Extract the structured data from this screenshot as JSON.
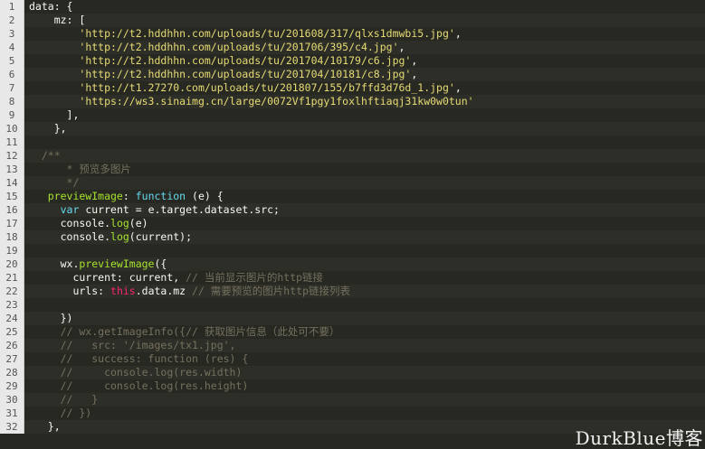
{
  "lines": [
    {
      "n": "1",
      "tokens": [
        {
          "t": "data: {",
          "c": "pl"
        }
      ]
    },
    {
      "n": "2",
      "tokens": [
        {
          "t": "    mz: [",
          "c": "pl"
        }
      ]
    },
    {
      "n": "3",
      "tokens": [
        {
          "t": "        ",
          "c": "pl"
        },
        {
          "t": "'http://t2.hddhhn.com/uploads/tu/201608/317/qlxs1dmwbi5.jpg'",
          "c": "str"
        },
        {
          "t": ",",
          "c": "pl"
        }
      ]
    },
    {
      "n": "4",
      "tokens": [
        {
          "t": "        ",
          "c": "pl"
        },
        {
          "t": "'http://t2.hddhhn.com/uploads/tu/201706/395/c4.jpg'",
          "c": "str"
        },
        {
          "t": ",",
          "c": "pl"
        }
      ]
    },
    {
      "n": "5",
      "tokens": [
        {
          "t": "        ",
          "c": "pl"
        },
        {
          "t": "'http://t2.hddhhn.com/uploads/tu/201704/10179/c6.jpg'",
          "c": "str"
        },
        {
          "t": ",",
          "c": "pl"
        }
      ]
    },
    {
      "n": "6",
      "tokens": [
        {
          "t": "        ",
          "c": "pl"
        },
        {
          "t": "'http://t2.hddhhn.com/uploads/tu/201704/10181/c8.jpg'",
          "c": "str"
        },
        {
          "t": ",",
          "c": "pl"
        }
      ]
    },
    {
      "n": "7",
      "tokens": [
        {
          "t": "        ",
          "c": "pl"
        },
        {
          "t": "'http://t1.27270.com/uploads/tu/201807/155/b7ffd3d76d_1.jpg'",
          "c": "str"
        },
        {
          "t": ",",
          "c": "pl"
        }
      ]
    },
    {
      "n": "8",
      "tokens": [
        {
          "t": "        ",
          "c": "pl"
        },
        {
          "t": "'https://ws3.sinaimg.cn/large/0072Vf1pgy1foxlhftiaqj31kw0w0tun'",
          "c": "str"
        }
      ]
    },
    {
      "n": "9",
      "tokens": [
        {
          "t": "      ],",
          "c": "pl"
        }
      ]
    },
    {
      "n": "10",
      "tokens": [
        {
          "t": "    },",
          "c": "pl"
        }
      ]
    },
    {
      "n": "11",
      "tokens": [
        {
          "t": "",
          "c": "pl"
        }
      ]
    },
    {
      "n": "12",
      "tokens": [
        {
          "t": "  /**",
          "c": "cm"
        }
      ]
    },
    {
      "n": "13",
      "tokens": [
        {
          "t": "      * 预览多图片",
          "c": "cm"
        }
      ]
    },
    {
      "n": "14",
      "tokens": [
        {
          "t": "      */",
          "c": "cm"
        }
      ]
    },
    {
      "n": "15",
      "tokens": [
        {
          "t": "   previewImage",
          "c": "fn"
        },
        {
          "t": ": ",
          "c": "pl"
        },
        {
          "t": "function",
          "c": "var"
        },
        {
          "t": " (e) {",
          "c": "pl"
        }
      ]
    },
    {
      "n": "16",
      "tokens": [
        {
          "t": "     ",
          "c": "pl"
        },
        {
          "t": "var",
          "c": "var"
        },
        {
          "t": " current = e.target.dataset.src;",
          "c": "pl"
        }
      ]
    },
    {
      "n": "17",
      "tokens": [
        {
          "t": "     console.",
          "c": "pl"
        },
        {
          "t": "log",
          "c": "fn"
        },
        {
          "t": "(e)",
          "c": "pl"
        }
      ]
    },
    {
      "n": "18",
      "tokens": [
        {
          "t": "     console.",
          "c": "pl"
        },
        {
          "t": "log",
          "c": "fn"
        },
        {
          "t": "(current);",
          "c": "pl"
        }
      ]
    },
    {
      "n": "19",
      "tokens": [
        {
          "t": "",
          "c": "pl"
        }
      ]
    },
    {
      "n": "20",
      "tokens": [
        {
          "t": "     wx.",
          "c": "pl"
        },
        {
          "t": "previewImage",
          "c": "fn"
        },
        {
          "t": "({",
          "c": "pl"
        }
      ]
    },
    {
      "n": "21",
      "tokens": [
        {
          "t": "       current: current, ",
          "c": "pl"
        },
        {
          "t": "// 当前显示图片的http链接",
          "c": "cm"
        }
      ]
    },
    {
      "n": "22",
      "tokens": [
        {
          "t": "       urls: ",
          "c": "pl"
        },
        {
          "t": "this",
          "c": "kw"
        },
        {
          "t": ".data.mz ",
          "c": "pl"
        },
        {
          "t": "// 需要预览的图片http链接列表",
          "c": "cm"
        }
      ]
    },
    {
      "n": "23",
      "tokens": [
        {
          "t": "",
          "c": "pl"
        }
      ]
    },
    {
      "n": "24",
      "tokens": [
        {
          "t": "     })",
          "c": "pl"
        }
      ]
    },
    {
      "n": "25",
      "tokens": [
        {
          "t": "     // wx.getImageInfo({// 获取图片信息（此处可不要）",
          "c": "cm"
        }
      ]
    },
    {
      "n": "26",
      "tokens": [
        {
          "t": "     //   src: '/images/tx1.jpg',",
          "c": "cm"
        }
      ]
    },
    {
      "n": "27",
      "tokens": [
        {
          "t": "     //   success: function (res) {",
          "c": "cm"
        }
      ]
    },
    {
      "n": "28",
      "tokens": [
        {
          "t": "     //     console.log(res.width)",
          "c": "cm"
        }
      ]
    },
    {
      "n": "29",
      "tokens": [
        {
          "t": "     //     console.log(res.height)",
          "c": "cm"
        }
      ]
    },
    {
      "n": "30",
      "tokens": [
        {
          "t": "     //   }",
          "c": "cm"
        }
      ]
    },
    {
      "n": "31",
      "tokens": [
        {
          "t": "     // })",
          "c": "cm"
        }
      ]
    },
    {
      "n": "32",
      "tokens": [
        {
          "t": "   },",
          "c": "pl"
        }
      ]
    }
  ],
  "watermark": "DurkBlue博客",
  "colors": {
    "background": "#272822",
    "gutter": "#e8e8e8",
    "string": "#e6db74",
    "comment": "#75715e",
    "keyword": "#66d9ef",
    "function": "#a6e22e"
  }
}
